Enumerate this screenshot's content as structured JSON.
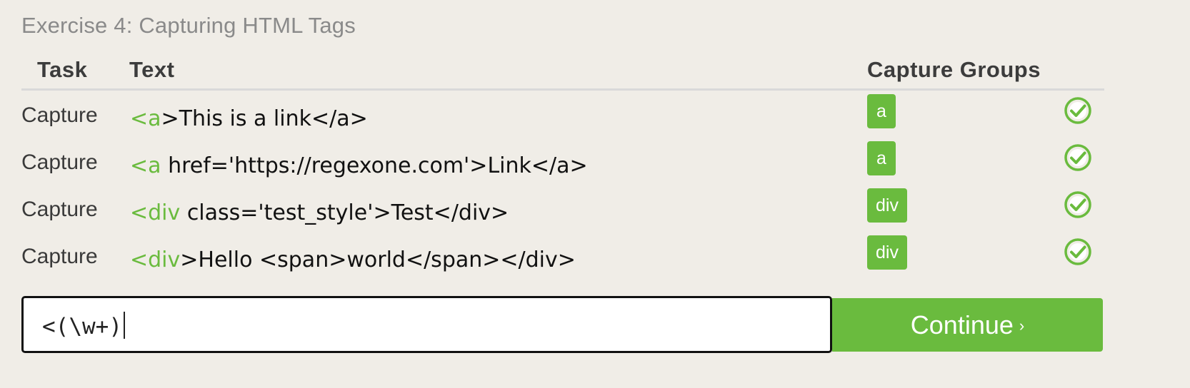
{
  "exercise": {
    "title": "Exercise 4: Capturing HTML Tags"
  },
  "columns": {
    "task": "Task",
    "text": "Text",
    "capture_groups": "Capture Groups"
  },
  "rows": [
    {
      "task": "Capture",
      "text_prefix": "<a",
      "text_rest": ">This is a link</a>",
      "group": "a",
      "status": "matched"
    },
    {
      "task": "Capture",
      "text_prefix": "<a",
      "text_rest": " href='https://regexone.com'>Link</a>",
      "group": "a",
      "status": "matched"
    },
    {
      "task": "Capture",
      "text_prefix": "<div",
      "text_rest": " class='test_style'>Test</div>",
      "group": "div",
      "status": "matched"
    },
    {
      "task": "Capture",
      "text_prefix": "<div",
      "text_rest": ">Hello <span>world</span></div>",
      "group": "div",
      "status": "matched"
    }
  ],
  "input": {
    "value": "<(\\w+)"
  },
  "continue_button": {
    "label": "Continue",
    "chevron": "›"
  },
  "icons": {
    "status": "check-circle-icon"
  },
  "colors": {
    "accent": "#6abb3e",
    "background": "#f0ede7"
  }
}
